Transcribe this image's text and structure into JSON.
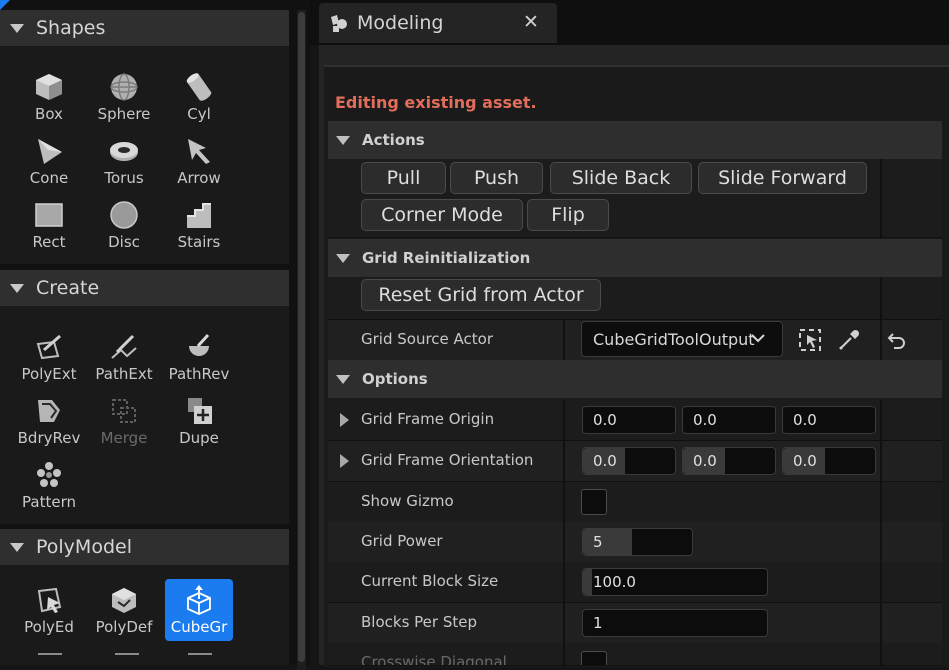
{
  "palette": {
    "sections": [
      {
        "title": "Shapes",
        "tools": [
          {
            "label": "Box",
            "icon": "box-icon"
          },
          {
            "label": "Sphere",
            "icon": "sphere-icon"
          },
          {
            "label": "Cyl",
            "icon": "cylinder-icon"
          },
          {
            "label": "Cone",
            "icon": "cone-icon"
          },
          {
            "label": "Torus",
            "icon": "torus-icon"
          },
          {
            "label": "Arrow",
            "icon": "arrow-icon"
          },
          {
            "label": "Rect",
            "icon": "rect-icon"
          },
          {
            "label": "Disc",
            "icon": "disc-icon"
          },
          {
            "label": "Stairs",
            "icon": "stairs-icon"
          }
        ]
      },
      {
        "title": "Create",
        "tools": [
          {
            "label": "PolyExt",
            "icon": "polyext-icon"
          },
          {
            "label": "PathExt",
            "icon": "pathext-icon"
          },
          {
            "label": "PathRev",
            "icon": "pathrev-icon"
          },
          {
            "label": "BdryRev",
            "icon": "bdryrev-icon"
          },
          {
            "label": "Merge",
            "icon": "merge-icon",
            "disabled": true
          },
          {
            "label": "Dupe",
            "icon": "dupe-icon"
          },
          {
            "label": "Pattern",
            "icon": "pattern-icon"
          }
        ]
      },
      {
        "title": "PolyModel",
        "tools": [
          {
            "label": "PolyEd",
            "icon": "polyed-icon"
          },
          {
            "label": "PolyDef",
            "icon": "polydef-icon"
          },
          {
            "label": "CubeGr",
            "icon": "cubegrid-icon",
            "active": true
          }
        ]
      }
    ]
  },
  "tab": {
    "title": "Modeling",
    "close_glyph": "✕"
  },
  "details": {
    "warning": "Editing existing asset.",
    "actions": {
      "header": "Actions",
      "buttons": [
        "Pull",
        "Push",
        "Slide Back",
        "Slide Forward",
        "Corner Mode",
        "Flip"
      ]
    },
    "grid_reinit": {
      "header": "Grid Reinitialization",
      "reset_button": "Reset Grid from Actor",
      "source_label": "Grid Source Actor",
      "source_value": "CubeGridToolOutput"
    },
    "options": {
      "header": "Options",
      "frame_origin": {
        "label": "Grid Frame Origin",
        "values": [
          "0.0",
          "0.0",
          "0.0"
        ]
      },
      "frame_orientation": {
        "label": "Grid Frame Orientation",
        "values": [
          "0.0",
          "0.0",
          "0.0"
        ]
      },
      "show_gizmo": {
        "label": "Show Gizmo",
        "checked": false
      },
      "grid_power": {
        "label": "Grid Power",
        "value": "5",
        "slider_fraction": 0.45
      },
      "block_size": {
        "label": "Current Block Size",
        "value": "100.0",
        "slider_fraction": 0.04
      },
      "blocks_per_step": {
        "label": "Blocks Per Step",
        "value": "1"
      },
      "crosswise_diagonal": {
        "label": "Crosswise Diagonal"
      }
    }
  },
  "colors": {
    "accent": "#1b7cf0",
    "warning": "#e36d5b"
  }
}
